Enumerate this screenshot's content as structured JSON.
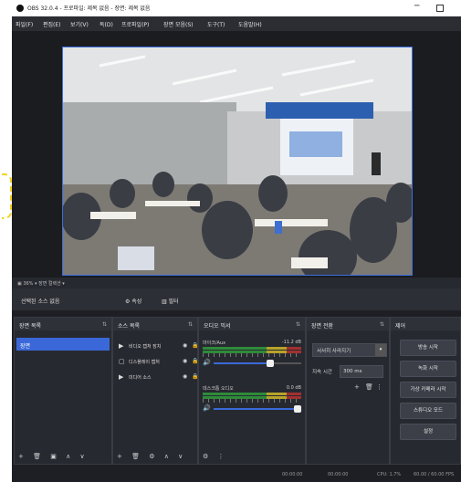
{
  "window": {
    "title": "OBS 32.0.4 - 프로파일: 제목 없음 - 장면: 제목 없음",
    "min_icon": "─"
  },
  "menu": [
    "파일(F)",
    "편집(E)",
    "보기(V)",
    "독(D)",
    "프로파일(P)",
    "장면 모음(S)",
    "도구(T)",
    "도움말(H)"
  ],
  "status_line": "▣ 36% ▾ 장면 컬렉션 ▾",
  "source_bar": {
    "label": "선택된 소스 없음",
    "properties": "⚙ 속성",
    "filters": "▥ 필터"
  },
  "scenes": {
    "title": "장면 목록",
    "items": [
      "장면"
    ],
    "toolbar": [
      "+",
      "🗑",
      "▣",
      "∧",
      "∨"
    ]
  },
  "sources": {
    "title": "소스 목록",
    "items": [
      {
        "icon": "▶",
        "name": "비디오 캡처 장치",
        "eye": "◉",
        "lock": "🔒"
      },
      {
        "icon": "▢",
        "name": "디스플레이 캡처",
        "eye": "◉",
        "lock": "🔒"
      },
      {
        "icon": "▶",
        "name": "미디어 소스",
        "eye": "◉",
        "lock": "🔒"
      }
    ],
    "toolbar": [
      "+",
      "🗑",
      "⚙",
      "∧",
      "∨"
    ]
  },
  "mixer": {
    "title": "오디오 믹서",
    "channels": [
      {
        "name": "마이크/Aux",
        "db": "-11.2 dB",
        "mute": "🔊"
      },
      {
        "name": "데스크톱 오디오",
        "db": "0.0 dB",
        "mute": "🔊"
      }
    ],
    "toolbar": [
      "⚙",
      "⋮"
    ]
  },
  "transitions": {
    "title": "장면 전환",
    "selected": "서서히 사라지기",
    "duration_label": "지속 시간",
    "duration_value": "300 ms",
    "toolbar": [
      "+",
      "🗑",
      "⋮"
    ]
  },
  "controls": {
    "title": "제어",
    "buttons": [
      "방송 시작",
      "녹화 시작",
      "가상 카메라 시작",
      "스튜디오 모드",
      "설정"
    ]
  },
  "footer": {
    "rec": "00:00:00",
    "stream": "00:00:00",
    "cpu": "CPU: 1.7%",
    "fps": "60.00 / 60.00 FPS"
  },
  "colors": {
    "accent": "#3a68d8",
    "bg": "#1e1f24",
    "panel": "#272930",
    "bracket": "#f4d418"
  }
}
